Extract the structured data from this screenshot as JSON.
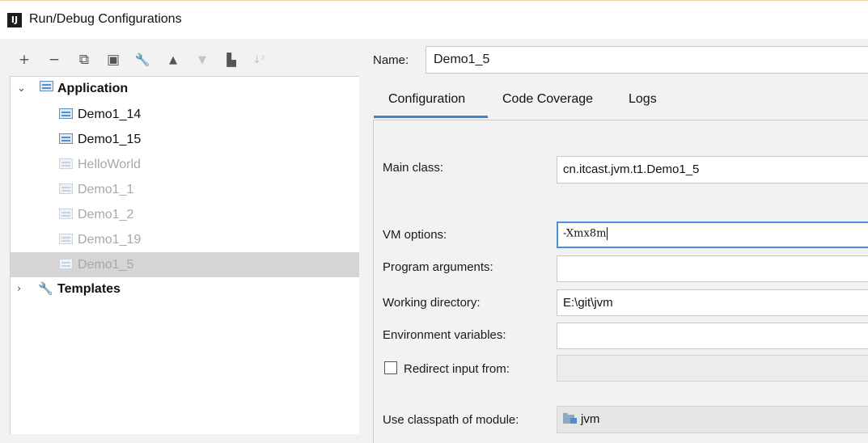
{
  "window": {
    "title": "Run/Debug Configurations",
    "app_icon": "IJ"
  },
  "toolbar": [
    {
      "name": "add-icon",
      "glyph": "+",
      "enabled": true
    },
    {
      "name": "remove-icon",
      "glyph": "−",
      "enabled": true
    },
    {
      "name": "copy-icon",
      "glyph": "⧉",
      "enabled": true
    },
    {
      "name": "save-icon",
      "glyph": "▣",
      "enabled": true
    },
    {
      "name": "wrench-icon",
      "glyph": "🔧",
      "enabled": true
    },
    {
      "name": "move-up-icon",
      "glyph": "▲",
      "enabled": true
    },
    {
      "name": "move-down-icon",
      "glyph": "▼",
      "enabled": false
    },
    {
      "name": "folder-icon",
      "glyph": "▙",
      "enabled": true
    },
    {
      "name": "sort-icon",
      "glyph": "↓ᶻ",
      "enabled": false
    }
  ],
  "tree": {
    "application": {
      "label": "Application",
      "expanded": true
    },
    "items": [
      {
        "label": "Demo1_14",
        "faded": false,
        "selected": false
      },
      {
        "label": "Demo1_15",
        "faded": false,
        "selected": false
      },
      {
        "label": "HelloWorld",
        "faded": true,
        "selected": false
      },
      {
        "label": "Demo1_1",
        "faded": true,
        "selected": false
      },
      {
        "label": "Demo1_2",
        "faded": true,
        "selected": false
      },
      {
        "label": "Demo1_19",
        "faded": true,
        "selected": false
      },
      {
        "label": "Demo1_5",
        "faded": true,
        "selected": true
      }
    ],
    "templates": {
      "label": "Templates",
      "expanded": false
    }
  },
  "name_field": {
    "label": "Name:",
    "value": "Demo1_5"
  },
  "tabs": [
    "Configuration",
    "Code Coverage",
    "Logs"
  ],
  "active_tab": "Configuration",
  "form": {
    "main_class": {
      "label": "Main class:",
      "value": "cn.itcast.jvm.t1.Demo1_5"
    },
    "vm_options": {
      "label": "VM options:",
      "value": "-Xmx8m"
    },
    "program_arguments": {
      "label": "Program arguments:",
      "value": ""
    },
    "working_directory": {
      "label": "Working directory:",
      "value": "E:\\git\\jvm"
    },
    "environment_variables": {
      "label": "Environment variables:",
      "value": ""
    },
    "redirect_input": {
      "label": "Redirect input from:",
      "checked": false,
      "value": ""
    },
    "classpath_module": {
      "label": "Use classpath of module:",
      "value": "jvm"
    }
  },
  "colors": {
    "accent": "#4083c9",
    "selection": "#d5d5d5",
    "background": "#f2f2f2"
  }
}
